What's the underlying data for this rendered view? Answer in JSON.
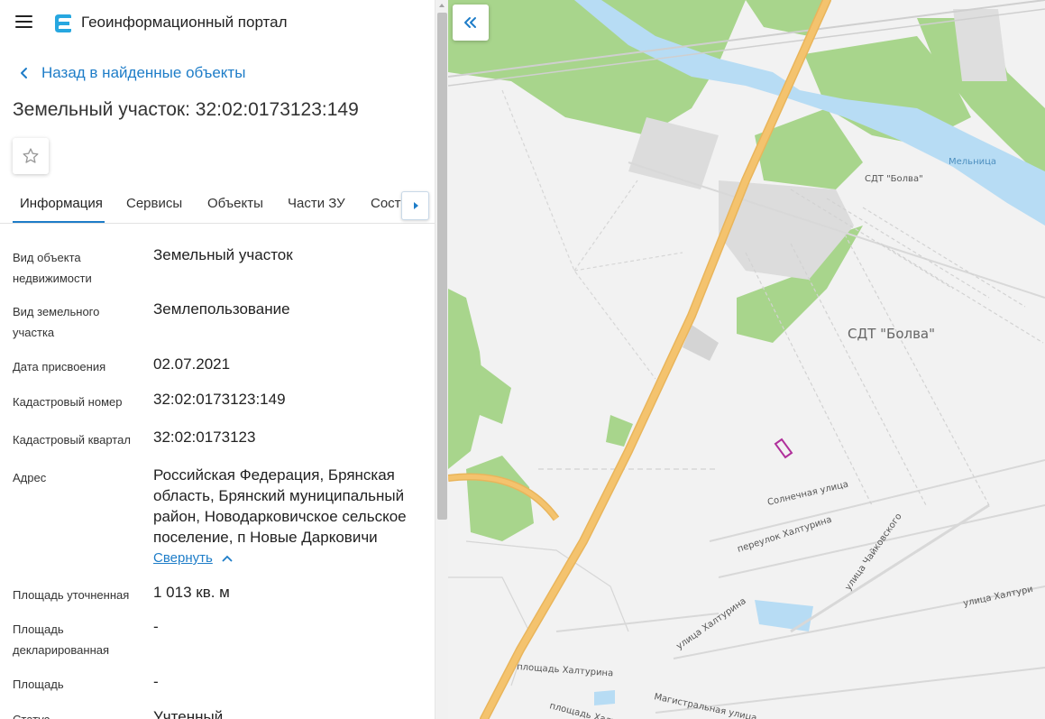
{
  "header": {
    "app_title": "Геоинформационный портал",
    "menu_icon": "hamburger-menu-icon",
    "logo_icon": "portal-logo-icon"
  },
  "navigation": {
    "back_label": "Назад в найденные объекты"
  },
  "object": {
    "title": "Земельный участок: 32:02:0173123:149"
  },
  "tabs": [
    {
      "label": "Информация",
      "active": true
    },
    {
      "label": "Сервисы",
      "active": false
    },
    {
      "label": "Объекты",
      "active": false
    },
    {
      "label": "Части ЗУ",
      "active": false
    },
    {
      "label": "Состав",
      "active": false
    }
  ],
  "info": [
    {
      "label": "Вид объекта недвижимости",
      "value": "Земельный участок"
    },
    {
      "label": "Вид земельного участка",
      "value": "Землепользование"
    },
    {
      "label": "Дата присвоения",
      "value": "02.07.2021"
    },
    {
      "label": "Кадастровый номер",
      "value": "32:02:0173123:149"
    },
    {
      "label": "Кадастровый квартал",
      "value": "32:02:0173123"
    },
    {
      "label": "Адрес",
      "value": "Российская Федерация, Брянская область, Брянский муниципальный район, Новодарковичское сельское поселение, п Новые Дарковичи"
    },
    {
      "label": "Площадь уточненная",
      "value": "1 013 кв. м"
    },
    {
      "label": "Площадь декларированная",
      "value": "-"
    },
    {
      "label": "Площадь",
      "value": "-"
    },
    {
      "label": "Статус",
      "value": "Учтенный"
    }
  ],
  "address_toggle_label": "Свернуть",
  "map": {
    "labels": {
      "river": "Мельница",
      "sdt_small": "СДТ \"Болва\"",
      "sdt_large": "СДТ \"Болва\"",
      "street_solnechnaya": "Солнечная улица",
      "street_pereulok": "переулок Халтурина",
      "street_chaikovskogo": "улица Чайковского",
      "street_khalturina_right": "улица Халтури",
      "street_khalturina_mid": "улица Халтурина",
      "square_khalturina": "площадь Халтурина",
      "square_khalturina_2": "площадь Халтурина",
      "street_magistralnaya": "Магистральная улица"
    },
    "colors": {
      "background": "#f2f2f2",
      "forest": "#a8d58c",
      "water": "#b7dcf4",
      "highway": "#f4c36e",
      "parcel": "#b0309b"
    }
  }
}
